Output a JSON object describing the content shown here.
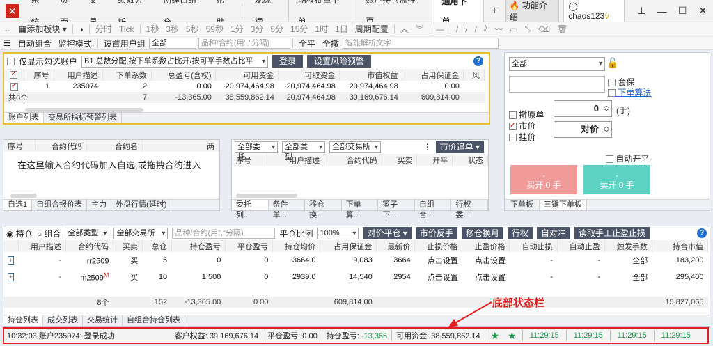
{
  "menubar": {
    "items": [
      "系统",
      "页面",
      "交易",
      "绩效分析",
      "创建自组合",
      "帮助"
    ],
    "tabs": [
      "龙虎榜",
      "期权批量下单",
      "账户持仓监控页",
      "通用下单"
    ],
    "active_tab": "通用下单",
    "func_intro": "功能介绍",
    "user": "chaos123",
    "user_badge": "V"
  },
  "toolbar1": {
    "add_block": "添加板块",
    "periods": [
      "分时",
      "Tick",
      "1秒",
      "3秒",
      "5秒",
      "59秒",
      "1分",
      "3分",
      "5分",
      "15分",
      "1时",
      "1日",
      "周期配置"
    ]
  },
  "toolbar2": {
    "auto_combo": "自动组合",
    "monitor_mode": "监控模式",
    "set_user_group": "设置用户组",
    "group_value": "全部",
    "search_placeholder": "品种/合约(用\",\"分隔)",
    "all_flat": "全平",
    "all_cancel": "全撤",
    "smart_placeholder": "智能解析文字"
  },
  "account": {
    "only_checked": "仅显示勾选账户",
    "alloc_mode": "B1.总数分配,按下单系数占比开/按可平手数占比平",
    "login": "登录",
    "risk_warn": "设置风险预警",
    "columns": [
      "序号",
      "用户描述",
      "下单系数",
      "总盈亏(含权)",
      "可用资金",
      "可取资金",
      "市值权益",
      "占用保证金",
      "风"
    ],
    "row": [
      "1",
      "235074",
      "2",
      "0.00",
      "20,974,464.98",
      "20,974,464.98",
      "20,974,464.98",
      "0.00"
    ],
    "sum": [
      "共6个",
      "",
      "7",
      "-13,365.00",
      "38,559,862.14",
      "20,974,464.98",
      "39,169,676.14",
      "609,814.00"
    ],
    "tabs": [
      "账户列表",
      "交易所指标预警列表"
    ]
  },
  "watch": {
    "columns": [
      "序号",
      "合约代码",
      "合约名",
      "两"
    ],
    "hint": "在这里输入合约代码加入自选,或拖拽合约进入",
    "tabs": [
      "自选1",
      "自组合报价表",
      "主力",
      "外盘行情(延时)"
    ]
  },
  "orders": {
    "filters": [
      "全部委托",
      "全部类型",
      "全部交易所"
    ],
    "market_chase": "市价追单",
    "columns": [
      "序号",
      "用户描述",
      "合约代码",
      "买卖",
      "开平",
      "状态"
    ],
    "tabs": [
      "委托列...",
      "条件单...",
      "移仓换...",
      "下单算...",
      "篮子下...",
      "自组合...",
      "行权委..."
    ]
  },
  "order_panel": {
    "account_select": "全部",
    "hedge": "套保",
    "algo": "下单算法",
    "cancel_order": "撤原单",
    "market_price": "市价",
    "hang": "挂价",
    "qty": "0",
    "qty_unit": "(手)",
    "price": "对价",
    "auto_open_close": "自动开平",
    "buy_dash": "-",
    "buy_label": "买开 0 手",
    "sell_dash": "-",
    "sell_label": "卖开 0 手",
    "tabs": [
      "下单板",
      "三键下单板"
    ]
  },
  "positions": {
    "radio_hold": "持仓",
    "radio_combo": "组合",
    "type_select": "全部类型",
    "exch_select": "全部交易所",
    "search_placeholder": "品种/合约(用\",\"分隔)",
    "close_ratio": "平仓比例",
    "ratio_value": "100%",
    "buttons": [
      "对价平仓",
      "市价反手",
      "移仓换月",
      "行权",
      "自对冲",
      "读取手工止盈止损"
    ],
    "columns": [
      "用户描述",
      "合约代码",
      "买卖",
      "总仓",
      "持仓盈亏",
      "平仓盈亏",
      "持仓均价",
      "占用保证金",
      "最新价",
      "止损价格",
      "止盈价格",
      "自动止损",
      "自动止盈",
      "触发手数",
      "持合市值"
    ],
    "rows": [
      [
        "-",
        "rr2509",
        "",
        "买",
        "5",
        "0",
        "0",
        "3664.0",
        "9,083",
        "3664",
        "点击设置",
        "点击设置",
        "-",
        "-",
        "全部",
        "183,200"
      ],
      [
        "-",
        "m2509",
        "M",
        "买",
        "10",
        "1,500",
        "0",
        "2939.0",
        "14,540",
        "2954",
        "点击设置",
        "点击设置",
        "-",
        "-",
        "全部",
        "295,400"
      ]
    ],
    "sum": [
      "8个",
      "",
      "152",
      "-13,365.00",
      "0.00",
      "",
      "609,814.00",
      "",
      "",
      "",
      "",
      "",
      "",
      "15,827,065"
    ],
    "tabs": [
      "持仓列表",
      "成交列表",
      "交易统计",
      "自组合持仓列表"
    ]
  },
  "status": {
    "time_login": "10:32:03 账户235074: 登录成功",
    "equity": "客户权益: 39,169,676.14",
    "close_pl": "平仓盈亏: 0.00",
    "hold_pl_label": "持仓盈亏:",
    "hold_pl_value": "-13,365",
    "available": "可用资金: 38,559,862.14",
    "times": [
      "11:29:15",
      "11:29:15",
      "11:29:15",
      "11:29:15"
    ]
  },
  "annotation": "底部状态栏",
  "colors": {
    "accent_red": "#e02020",
    "buy_btn": "#f09a9a",
    "sell_btn": "#5fd3c3",
    "dark_btn": "#4a5466",
    "highlight_border": "#e8c030"
  }
}
